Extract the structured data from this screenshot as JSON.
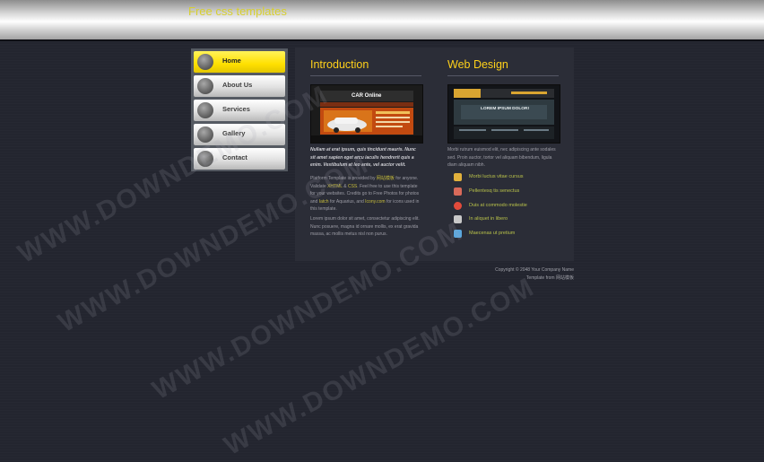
{
  "header": {
    "title": "Free css templates"
  },
  "nav": {
    "items": [
      {
        "label": "Home",
        "active": true
      },
      {
        "label": "About Us",
        "active": false
      },
      {
        "label": "Services",
        "active": false
      },
      {
        "label": "Gallery",
        "active": false
      },
      {
        "label": "Contact",
        "active": false
      }
    ]
  },
  "intro": {
    "title": "Introduction",
    "thumb_title": "CAR Online",
    "bold_text": "Nullam at erat ipsum, quis tincidunt mauris. Nunc sit amet sapien eget arcu iaculis hendrerit quis a enim. Vestibulum at leo ante, vel auctor velit.",
    "p2_part1": "Platform Template is provided by",
    "p2_link1": "网站模板",
    "p2_part2": "for anyone. Validate",
    "p2_link2": "XHTML",
    "p2_amp": "&",
    "p2_link3": "CSS",
    "p2_part3": ". Feel free to use this template for your websites. Credits go to Free Photos for photos and",
    "p2_link4": "Iatch",
    "p2_part4": "for Aquarius, and",
    "p2_link5": "Icony.com",
    "p2_part5": "for icons used in this template.",
    "p3": "Lorem ipsum dolor sit amet, consectetur adipiscing elit. Nunc posuere, magna id ornare mollis, ex erat gravida massa, ac mollis metus nisl non purus."
  },
  "webdesign": {
    "title": "Web Design",
    "thumb_banner": "LOREM IPSUM DOLOR!",
    "text": "Morbi rutrum euismod elit, nec adipiscing ante sodales sed. Proin auctor, tortor vel aliquam bibendum, ligula diam aliquam nibh.",
    "features": [
      {
        "label": "Morbi luctus vitae cursus",
        "icon": "people-icon",
        "color": "#e2b13c"
      },
      {
        "label": "Pellentesq tis senectus",
        "icon": "calendar-icon",
        "color": "#d96a5a"
      },
      {
        "label": "Duis at commodo molestie",
        "icon": "lifebuoy-icon",
        "color": "#e34b3b"
      },
      {
        "label": "In aliquet in libero",
        "icon": "tools-icon",
        "color": "#c8c8c8"
      },
      {
        "label": "Maecenas ut pretium",
        "icon": "monitor-icon",
        "color": "#5aa7de"
      }
    ]
  },
  "footer": {
    "copyright": "Copyright © 2048 Your Company Name",
    "credit": "Template from 网站模板"
  },
  "watermark": {
    "text": "WWW.DOWNDEMO.COM"
  },
  "colors": {
    "accent": "#ffd11a",
    "link": "#c7bd3a",
    "nav_active": "#ffe000",
    "background": "#23252f"
  }
}
